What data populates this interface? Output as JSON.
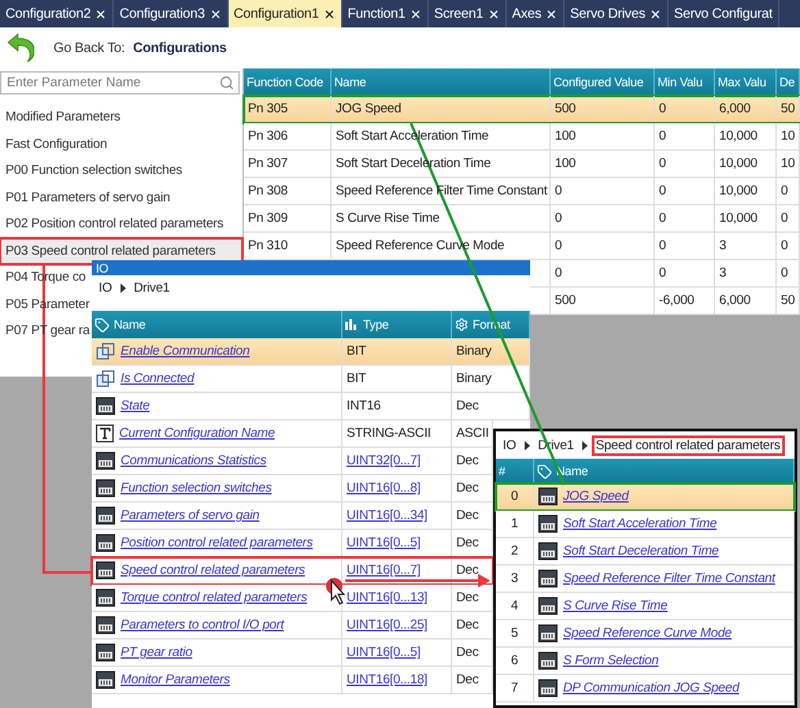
{
  "tabs": [
    {
      "label": "Configuration2",
      "selected": false,
      "closable": true
    },
    {
      "label": "Configuration3",
      "selected": false,
      "closable": true
    },
    {
      "label": "Configuration1",
      "selected": true,
      "closable": true
    },
    {
      "label": "Function1",
      "selected": false,
      "closable": true
    },
    {
      "label": "Screen1",
      "selected": false,
      "closable": true
    },
    {
      "label": "Axes",
      "selected": false,
      "closable": true
    },
    {
      "label": "Servo Drives",
      "selected": false,
      "closable": true
    },
    {
      "label": "Servo Configurat",
      "selected": false,
      "closable": false
    }
  ],
  "go_back": {
    "label": "Go Back To:",
    "target": "Configurations"
  },
  "search": {
    "placeholder": "Enter Parameter Name"
  },
  "parameter_groups": [
    {
      "label": "Modified Parameters",
      "selected": false
    },
    {
      "label": "Fast Configuration",
      "selected": false
    },
    {
      "label": "P00 Function selection switches",
      "selected": false
    },
    {
      "label": "P01 Parameters of servo gain",
      "selected": false
    },
    {
      "label": "P02 Position control related parameters",
      "selected": false
    },
    {
      "label": "P03 Speed control related parameters",
      "selected": true,
      "outlined": true
    },
    {
      "label": "P04 Torque co",
      "selected": false
    },
    {
      "label": "P05 Parameter",
      "selected": false
    },
    {
      "label": "P07 PT gear ra",
      "selected": false
    }
  ],
  "parameter_table": {
    "columns": [
      "Function Code",
      "Name",
      "Configured Value",
      "Min Valu",
      "Max Valu",
      "De"
    ],
    "rows": [
      {
        "cells": [
          "Pn 305",
          "JOG Speed",
          "500",
          "0",
          "6,000",
          "50"
        ],
        "selected": true,
        "outlined": true
      },
      {
        "cells": [
          "Pn 306",
          "Soft Start Acceleration Time",
          "100",
          "0",
          "10,000",
          "10"
        ],
        "selected": false
      },
      {
        "cells": [
          "Pn 307",
          "Soft Start Deceleration Time",
          "100",
          "0",
          "10,000",
          "10"
        ],
        "selected": false
      },
      {
        "cells": [
          "Pn 308",
          "Speed Reference Filter Time Constant",
          "0",
          "0",
          "10,000",
          "0"
        ],
        "selected": false
      },
      {
        "cells": [
          "Pn 309",
          "S Curve Rise Time",
          "0",
          "0",
          "10,000",
          "0"
        ],
        "selected": false
      },
      {
        "cells": [
          "Pn 310",
          "Speed Reference Curve Mode",
          "0",
          "0",
          "3",
          "0"
        ],
        "selected": false
      },
      {
        "cells": [
          null,
          null,
          "0",
          "0",
          "3",
          "0"
        ],
        "selected": false
      },
      {
        "cells": [
          null,
          null,
          "500",
          "-6,000",
          "6,000",
          "50"
        ],
        "selected": false
      }
    ]
  },
  "io_window": {
    "title": "IO",
    "breadcrumb": [
      {
        "label": "IO"
      },
      {
        "label": "Drive1"
      }
    ],
    "columns": [
      "Name",
      "Type",
      "Format"
    ],
    "rows": [
      {
        "kind": "bit",
        "name": "Enable Communication",
        "type": "BIT",
        "type_link": false,
        "format": "Binary",
        "selected": true
      },
      {
        "kind": "bit",
        "name": "Is Connected",
        "type": "BIT",
        "type_link": false,
        "format": "Binary",
        "selected": false
      },
      {
        "kind": "number",
        "name": "State",
        "type": "INT16",
        "type_link": false,
        "format": "Dec",
        "selected": false
      },
      {
        "kind": "text",
        "name": "Current Configuration Name",
        "type": "STRING-ASCII",
        "type_link": false,
        "format": "ASCII",
        "selected": false
      },
      {
        "kind": "number",
        "name": "Communications Statistics",
        "type": "UINT32[0...7]",
        "type_link": true,
        "format": "Dec",
        "selected": false
      },
      {
        "kind": "number",
        "name": "Function selection switches",
        "type": "UINT16[0...8]",
        "type_link": true,
        "format": "Dec",
        "selected": false
      },
      {
        "kind": "number",
        "name": "Parameters of servo gain",
        "type": "UINT16[0...34]",
        "type_link": true,
        "format": "Dec",
        "selected": false
      },
      {
        "kind": "number",
        "name": "Position control related parameters",
        "type": "UINT16[0...5]",
        "type_link": true,
        "format": "Dec",
        "selected": false
      },
      {
        "kind": "number",
        "name": "Speed control related parameters",
        "type": "UINT16[0...7]",
        "type_link": true,
        "format": "Dec",
        "selected": false,
        "outlined": true
      },
      {
        "kind": "number",
        "name": "Torque control related parameters",
        "type": "UINT16[0...13]",
        "type_link": true,
        "format": "Dec",
        "selected": false
      },
      {
        "kind": "number",
        "name": "Parameters to control I/O port",
        "type": "UINT16[0...25]",
        "type_link": true,
        "format": "Dec",
        "selected": false
      },
      {
        "kind": "number",
        "name": "PT gear ratio",
        "type": "UINT16[0...5]",
        "type_link": true,
        "format": "Dec",
        "selected": false
      },
      {
        "kind": "number",
        "name": "Monitor Parameters",
        "type": "UINT16[0...18]",
        "type_link": true,
        "format": "Dec",
        "selected": false
      }
    ]
  },
  "detail_window": {
    "breadcrumb": [
      {
        "label": "IO"
      },
      {
        "label": "Drive1"
      },
      {
        "label": "Speed control related parameters",
        "outlined": true
      }
    ],
    "columns": [
      "#",
      "Name"
    ],
    "rows": [
      {
        "index": "0",
        "name": "JOG Speed",
        "selected": true,
        "outlined": true
      },
      {
        "index": "1",
        "name": "Soft Start Acceleration Time",
        "selected": false
      },
      {
        "index": "2",
        "name": "Soft Start Deceleration Time",
        "selected": false
      },
      {
        "index": "3",
        "name": "Speed Reference Filter Time Constant",
        "selected": false
      },
      {
        "index": "4",
        "name": "S Curve Rise Time",
        "selected": false
      },
      {
        "index": "5",
        "name": "Speed Reference Curve Mode",
        "selected": false
      },
      {
        "index": "6",
        "name": "S Form Selection",
        "selected": false
      },
      {
        "index": "7",
        "name": "DP Communication JOG Speed",
        "selected": false
      }
    ]
  }
}
